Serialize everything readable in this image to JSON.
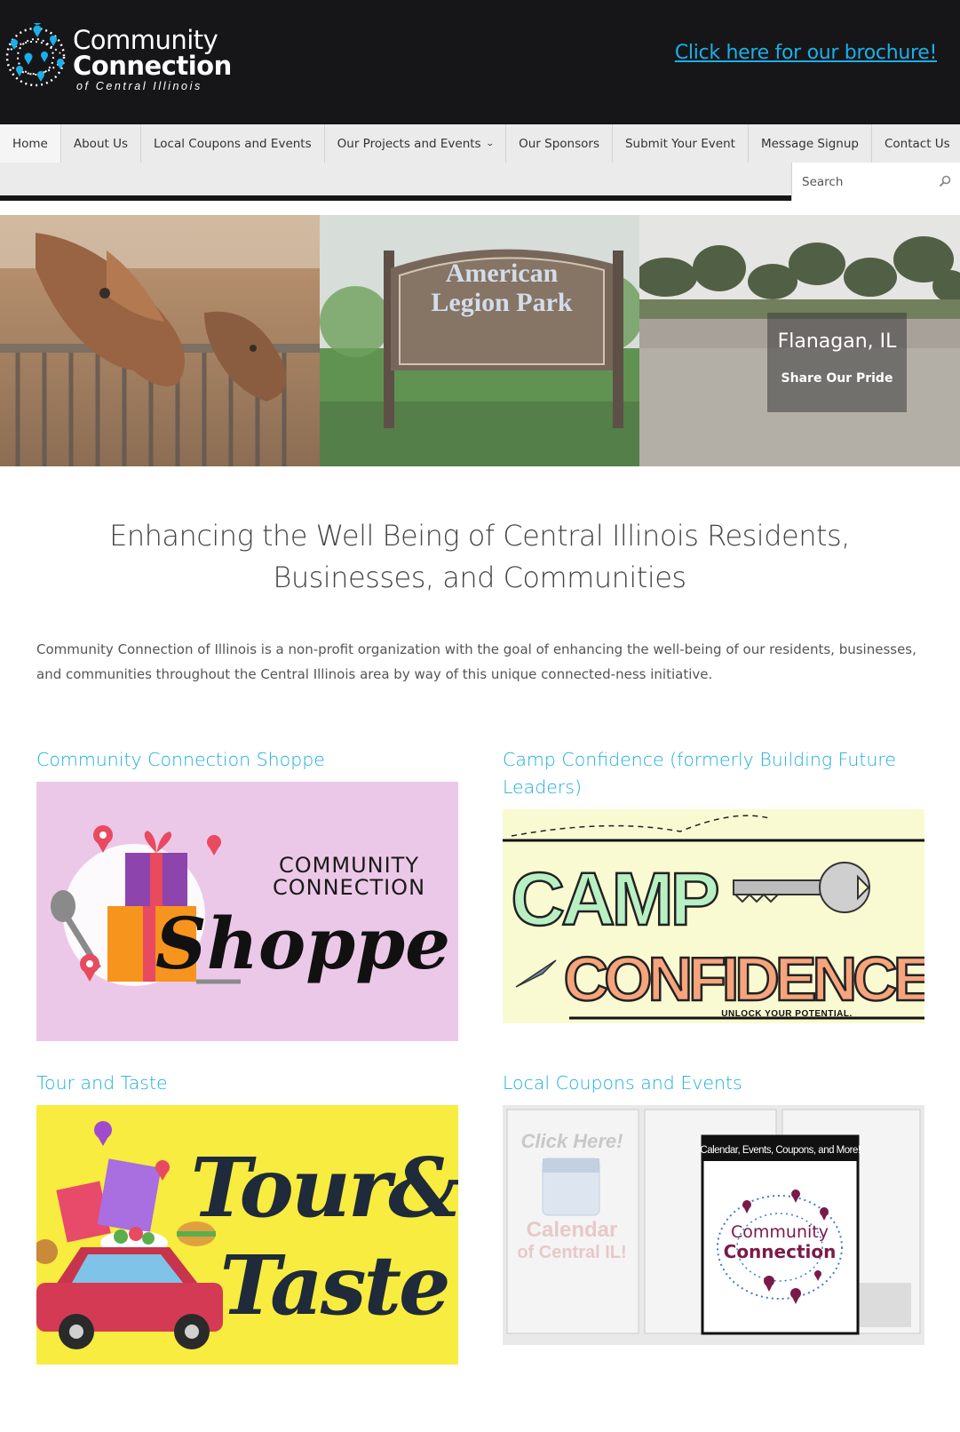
{
  "header": {
    "logo": {
      "line1": "Community",
      "line2": "Connection",
      "line3": "of Central Illinois"
    },
    "brochure_link": "Click here for our brochure!"
  },
  "nav": {
    "items": [
      {
        "label": "Home"
      },
      {
        "label": "About Us"
      },
      {
        "label": "Local Coupons and Events"
      },
      {
        "label": "Our Projects and Events",
        "has_dropdown": true
      },
      {
        "label": "Our Sponsors"
      },
      {
        "label": "Submit Your Event"
      },
      {
        "label": "Message Signup"
      },
      {
        "label": "Contact Us"
      }
    ],
    "search_placeholder": "Search"
  },
  "slider": {
    "caption_title": "Flanagan, IL",
    "caption_link": "Share Our Pride",
    "sign_line1": "American",
    "sign_line2": "Legion Park"
  },
  "main": {
    "headline": "Enhancing the Well Being of Central Illinois Residents, Businesses, and Communities",
    "intro": "Community Connection of Illinois is a non-profit organization with the goal of enhancing the well-being of our residents, businesses, and communities throughout the Central Illinois area by way of this unique connected-ness initiative."
  },
  "cards": [
    {
      "title": "Community Connection Shoppe",
      "art": {
        "line1": "COMMUNITY",
        "line2": "CONNECTION",
        "line3": "Shoppe"
      }
    },
    {
      "title": "Camp Confidence (formerly Building Future Leaders)",
      "art": {
        "line1": "CAMP",
        "line2": "CONFIDENCE",
        "line3": "UNLOCK YOUR POTENTIAL."
      }
    },
    {
      "title": "Tour and Taste",
      "art": {
        "line1": "Tour&",
        "line2": "Taste"
      }
    },
    {
      "title": "Local Coupons and Events",
      "art": {
        "banner": "Calendar, Events, Coupons, and More!",
        "line1": "Community",
        "line2": "Connection",
        "click": "Click Here!",
        "cal1": "Calendar",
        "cal2": "of Central IL!"
      }
    }
  ],
  "colors": {
    "header_bg": "#161618",
    "accent": "#1aaede",
    "brochure_link": "#1ab0e8",
    "nav_bg": "#ebebeb",
    "shoppe_bg": "#ecc8e8",
    "camp_bg": "#fafad2",
    "tour_bg": "#f7ec3f"
  }
}
